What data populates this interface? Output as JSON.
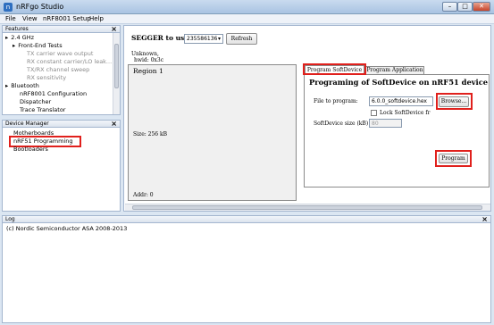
{
  "window": {
    "title": "nRFgo Studio",
    "min": "–",
    "max": "□",
    "close": "✕"
  },
  "menu": [
    "File",
    "View",
    "nRF8001 Setup",
    "Help"
  ],
  "features": {
    "title": "Features",
    "items": [
      {
        "label": "2.4 GHz",
        "level": 0,
        "expander": "▸"
      },
      {
        "label": "Front-End Tests",
        "level": 1,
        "expander": "▸"
      },
      {
        "label": "TX carrier wave output",
        "level": 2,
        "expander": ""
      },
      {
        "label": "RX constant carrier/LO leak...",
        "level": 2,
        "expander": ""
      },
      {
        "label": "TX/RX channel sweep",
        "level": 2,
        "expander": ""
      },
      {
        "label": "RX sensitivity",
        "level": 2,
        "expander": ""
      },
      {
        "label": "Bluetooth",
        "level": 0,
        "expander": "▸"
      },
      {
        "label": "nRF8001 Configuration",
        "level": 1,
        "expander": ""
      },
      {
        "label": "Dispatcher",
        "level": 1,
        "expander": ""
      },
      {
        "label": "Trace Translator",
        "level": 1,
        "expander": ""
      }
    ]
  },
  "device_manager": {
    "title": "Device Manager",
    "items": [
      "Motherboards",
      "nRF51 Programming",
      "Bootloaders"
    ]
  },
  "segger": {
    "label": "SEGGER to use:",
    "value": "235586136",
    "refresh": "Refresh"
  },
  "device_info": {
    "line1": "Unknown,",
    "line2": "hwid: 0x3c"
  },
  "region": {
    "title": "Region 1",
    "size": "Size: 256 kB",
    "addr": "Addr: 0"
  },
  "tabs": [
    "Program SoftDevice",
    "Program Application"
  ],
  "program_softdevice": {
    "heading": "Programing of SoftDevice on nRF51 device",
    "file_label": "File to program:",
    "file_value": "6.0.0_softdevice.hex",
    "browse": "Browse...",
    "lock_label": "Lock SoftDevice fr",
    "size_label": "SoftDevice size (kB)",
    "size_value": "80",
    "program": "Program"
  },
  "log": {
    "title": "Log",
    "line": "(c) Nordic Semiconductor ASA 2008-2013"
  },
  "icons": {
    "close": "×",
    "dropdown": "▾",
    "scroll_up": "▴",
    "scroll_down": "▾"
  },
  "colors": {
    "highlight": "#e0201c",
    "titlebar": "#a9c3e2"
  }
}
